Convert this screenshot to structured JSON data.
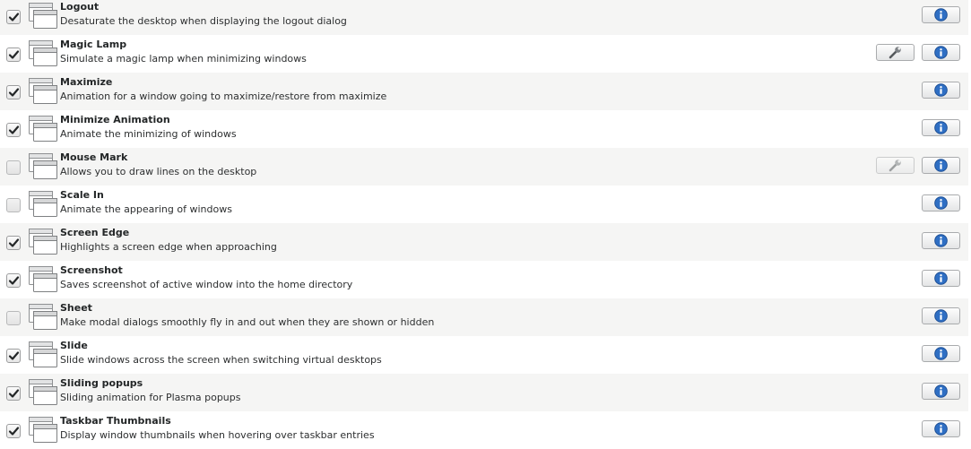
{
  "effects": [
    {
      "name": "Logout",
      "description": "Desaturate the desktop when displaying the logout dialog",
      "checked": true,
      "configurable": false,
      "config_enabled": false
    },
    {
      "name": "Magic Lamp",
      "description": "Simulate a magic lamp when minimizing windows",
      "checked": true,
      "configurable": true,
      "config_enabled": true
    },
    {
      "name": "Maximize",
      "description": "Animation for a window going to maximize/restore from maximize",
      "checked": true,
      "configurable": false,
      "config_enabled": false
    },
    {
      "name": "Minimize Animation",
      "description": "Animate the minimizing of windows",
      "checked": true,
      "configurable": false,
      "config_enabled": false
    },
    {
      "name": "Mouse Mark",
      "description": "Allows you to draw lines on the desktop",
      "checked": false,
      "configurable": true,
      "config_enabled": false
    },
    {
      "name": "Scale In",
      "description": "Animate the appearing of windows",
      "checked": false,
      "configurable": false,
      "config_enabled": false
    },
    {
      "name": "Screen Edge",
      "description": "Highlights a screen edge when approaching",
      "checked": true,
      "configurable": false,
      "config_enabled": false
    },
    {
      "name": "Screenshot",
      "description": "Saves screenshot of active window into the home directory",
      "checked": true,
      "configurable": false,
      "config_enabled": false
    },
    {
      "name": "Sheet",
      "description": "Make modal dialogs smoothly fly in and out when they are shown or hidden",
      "checked": false,
      "configurable": false,
      "config_enabled": false
    },
    {
      "name": "Slide",
      "description": "Slide windows across the screen when switching virtual desktops",
      "checked": true,
      "configurable": false,
      "config_enabled": false
    },
    {
      "name": "Sliding popups",
      "description": "Sliding animation for Plasma popups",
      "checked": true,
      "configurable": false,
      "config_enabled": false
    },
    {
      "name": "Taskbar Thumbnails",
      "description": "Display window thumbnails when hovering over taskbar entries",
      "checked": true,
      "configurable": false,
      "config_enabled": false
    }
  ],
  "icons": {
    "effect": "window-icon",
    "info": "info-icon",
    "configure": "wrench-icon",
    "check": "checkmark-icon"
  },
  "colors": {
    "row_alt": "#f5f5f4",
    "row_plain": "#ffffff",
    "info_blue": "#2f6fc4"
  }
}
